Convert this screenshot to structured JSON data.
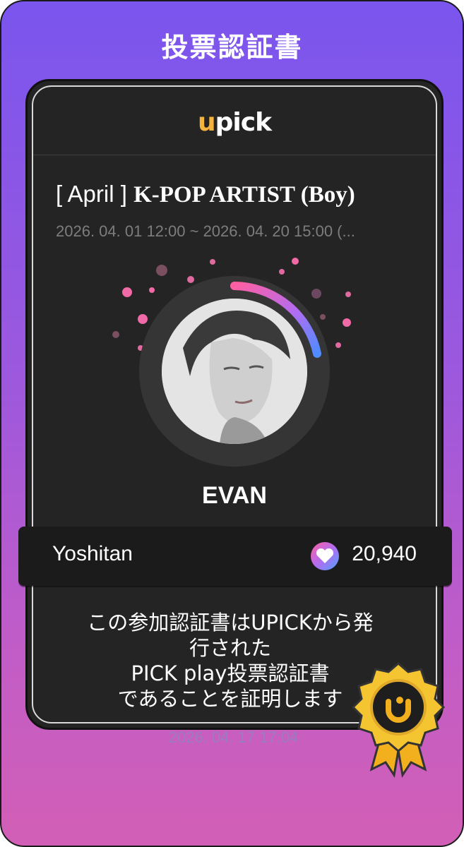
{
  "header": {
    "title": "投票認証書"
  },
  "logo": {
    "u": "u",
    "rest": "pick"
  },
  "event": {
    "bracket_open": "[ ",
    "month": "April",
    "bracket_close": " ] ",
    "category": "K-POP ARTIST (Boy)",
    "period": "2026. 04. 01 12:00 ~ 2026. 04. 20 15:00 (..."
  },
  "artist": {
    "name": "EVAN"
  },
  "vote": {
    "voter": "Yoshitan",
    "count": "20,940",
    "icon": "heart-icon"
  },
  "certificate": {
    "line1": "この参加認証書はUPICKから発",
    "line2": "行された",
    "line3": "PICK play投票認証書",
    "line4": "であることを証明します"
  },
  "issued_at": "2026. 04. 17 17:04",
  "colors": {
    "bg_top": "#7a55ee",
    "bg_bottom": "#d25fb6",
    "card": "#242424",
    "accent_pink": "#ff5fa2",
    "accent_blue": "#4f8cff",
    "seal_gold": "#f2c12e"
  }
}
